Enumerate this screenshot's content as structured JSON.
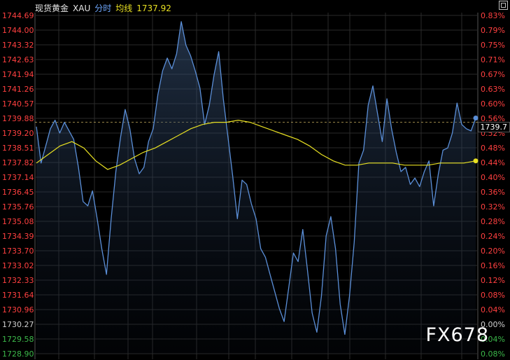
{
  "header": {
    "title": "现货黄金",
    "symbol": "XAU",
    "tab_intraday": "分时",
    "ma_label": "均线",
    "ma_value": "1737.92"
  },
  "watermark": "FX678",
  "last_price_label": "1739.7",
  "colors": {
    "price_line": "#5b8fd8",
    "ma_line": "#e8e022",
    "up": "#ff4040",
    "down": "#3cb84a",
    "neutral": "#d0d0d0",
    "grid": "#2a2a2a",
    "ref_line": "#c8b060"
  },
  "chart_data": {
    "type": "line",
    "title": "",
    "xlabel": "",
    "ylabel": "",
    "ylim": [
      1728.9,
      1744.69
    ],
    "reference_price": 1730.27,
    "y_ticks_left": [
      "1744.69",
      "1744.00",
      "1743.32",
      "1742.63",
      "1741.94",
      "1741.26",
      "1740.57",
      "1739.88",
      "1739.20",
      "1738.51",
      "1737.82",
      "1737.14",
      "1736.45",
      "1735.76",
      "1735.08",
      "1734.39",
      "1733.70",
      "1733.02",
      "1732.33",
      "1731.64",
      "1730.96",
      "1730.27",
      "1729.58",
      "1728.90"
    ],
    "y_ticks_right": [
      "0.83%",
      "0.79%",
      "0.75%",
      "0.71%",
      "0.67%",
      "0.63%",
      "0.60%",
      "0.56%",
      "0.52%",
      "0.48%",
      "0.44%",
      "0.40%",
      "0.36%",
      "0.32%",
      "0.28%",
      "0.24%",
      "0.20%",
      "0.16%",
      "0.12%",
      "0.08%",
      "0.04%",
      "0.00%",
      "0.04%",
      "0.08%"
    ],
    "series": [
      {
        "values": [
          1739.5,
          1737.8,
          1738.6,
          1739.4,
          1739.8,
          1739.2,
          1739.7,
          1739.3,
          1738.9,
          1737.6,
          1736.0,
          1735.8,
          1736.5,
          1735.2,
          1733.8,
          1732.6,
          1735.2,
          1737.4,
          1739.0,
          1740.3,
          1739.4,
          1738.0,
          1737.3,
          1737.6,
          1738.8,
          1739.4,
          1741.0,
          1742.1,
          1742.7,
          1742.2,
          1742.9,
          1744.4,
          1743.3,
          1742.8,
          1742.1,
          1741.3,
          1739.6,
          1740.5,
          1741.9,
          1743.0,
          1740.8,
          1739.0,
          1737.2,
          1735.2,
          1737.0,
          1736.8,
          1735.9,
          1735.2,
          1733.8,
          1733.4,
          1732.6,
          1731.8,
          1731.0,
          1730.4,
          1732.0,
          1733.6,
          1733.2,
          1734.7,
          1732.8,
          1730.8,
          1729.9,
          1731.6,
          1734.4,
          1735.3,
          1733.8,
          1731.2,
          1729.8,
          1731.6,
          1734.1,
          1737.8,
          1738.4,
          1740.5,
          1741.4,
          1740.1,
          1738.8,
          1740.8,
          1739.4,
          1738.3,
          1737.4,
          1737.6,
          1736.8,
          1737.1,
          1736.7,
          1737.4,
          1737.9,
          1735.8,
          1737.3,
          1738.4,
          1738.5,
          1739.2,
          1740.6,
          1739.6,
          1739.4,
          1739.3,
          1739.9
        ]
      },
      {
        "values": [
          1737.8,
          1738.2,
          1738.6,
          1738.8,
          1738.5,
          1737.9,
          1737.5,
          1737.7,
          1738.0,
          1738.3,
          1738.5,
          1738.8,
          1739.1,
          1739.4,
          1739.6,
          1739.7,
          1739.7,
          1739.8,
          1739.7,
          1739.5,
          1739.3,
          1739.1,
          1738.9,
          1738.6,
          1738.2,
          1737.9,
          1737.7,
          1737.7,
          1737.8,
          1737.8,
          1737.8,
          1737.7,
          1737.7,
          1737.7,
          1737.8,
          1737.8,
          1737.8,
          1737.9
        ]
      }
    ]
  }
}
